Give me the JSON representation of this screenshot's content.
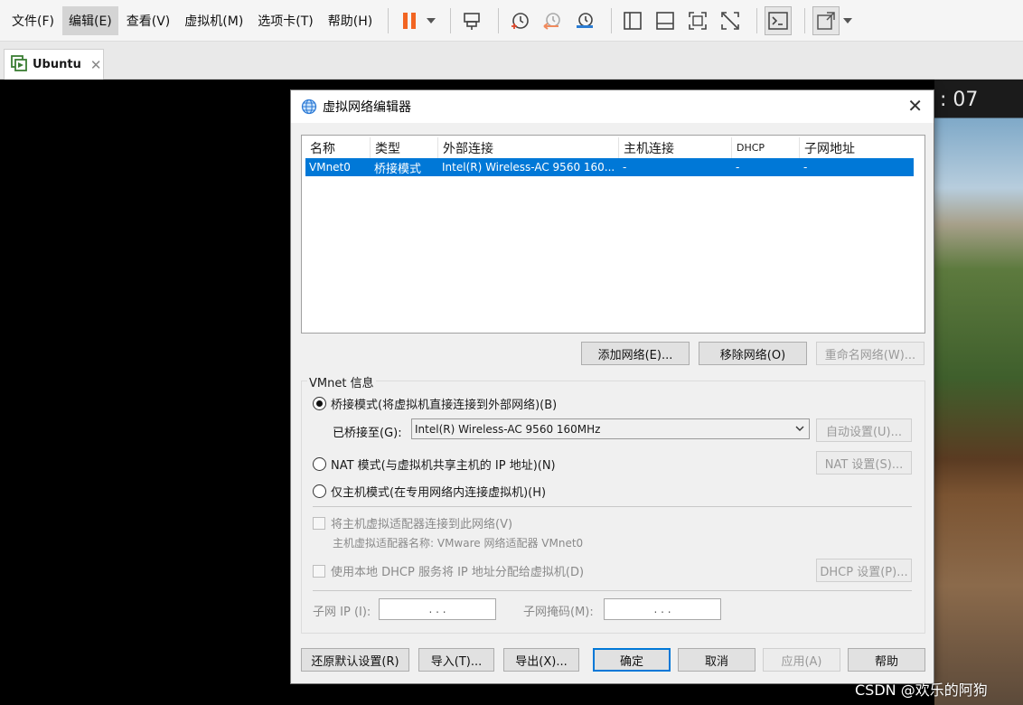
{
  "menubar": {
    "items": [
      "文件(F)",
      "编辑(E)",
      "查看(V)",
      "虚拟机(M)",
      "选项卡(T)",
      "帮助(H)"
    ],
    "active_index": 1,
    "toolbar_icons": [
      "pause-icon",
      "dropdown-caret-icon",
      "send-keys-icon",
      "snapshot-take-icon",
      "snapshot-revert-icon",
      "snapshot-manager-icon",
      "show-library-icon",
      "thumbnail-bar-icon",
      "full-screen-icon",
      "unity-icon",
      "console-view-icon",
      "stretch-guest-icon",
      "dropdown-caret-icon"
    ]
  },
  "tabs": [
    {
      "label": "Ubuntu",
      "close": "✕"
    }
  ],
  "vm": {
    "clock_fragment": ": 07"
  },
  "dialog": {
    "title": "虚拟网络编辑器",
    "close": "✕",
    "table": {
      "columns": [
        "名称",
        "类型",
        "外部连接",
        "主机连接",
        "DHCP",
        "子网地址"
      ],
      "rows": [
        [
          "VMnet0",
          "桥接模式",
          "Intel(R) Wireless-AC 9560 160...",
          "-",
          "-",
          "-"
        ]
      ],
      "selected_row": 0
    },
    "buttons": {
      "add_network": "添加网络(E)...",
      "remove_network": "移除网络(O)",
      "rename_network": "重命名网络(W)..."
    },
    "vmnet_info": {
      "label": "VMnet 信息",
      "bridged_radio": "桥接模式(将虚拟机直接连接到外部网络)(B)",
      "bridged_to_label": "已桥接至(G):",
      "bridged_to_value": "Intel(R) Wireless-AC 9560 160MHz",
      "auto_settings": "自动设置(U)...",
      "nat_radio": "NAT 模式(与虚拟机共享主机的 IP 地址)(N)",
      "nat_settings": "NAT 设置(S)...",
      "host_only_radio": "仅主机模式(在专用网络内连接虚拟机)(H)",
      "selected_mode": "bridged",
      "connect_adapter_checkbox": "将主机虚拟适配器连接到此网络(V)",
      "adapter_name_text": "主机虚拟适配器名称: VMware 网络适配器 VMnet0",
      "dhcp_checkbox": "使用本地 DHCP 服务将 IP 地址分配给虚拟机(D)",
      "dhcp_settings": "DHCP 设置(P)...",
      "subnet_ip_label": "子网 IP (I):",
      "subnet_ip_value": ".   .   .",
      "subnet_mask_label": "子网掩码(M):",
      "subnet_mask_value": ".   .   ."
    },
    "footer": {
      "restore_defaults": "还原默认设置(R)",
      "import": "导入(T)...",
      "export": "导出(X)...",
      "ok": "确定",
      "cancel": "取消",
      "apply": "应用(A)",
      "help": "帮助"
    }
  },
  "watermark": "CSDN @欢乐的阿狗"
}
